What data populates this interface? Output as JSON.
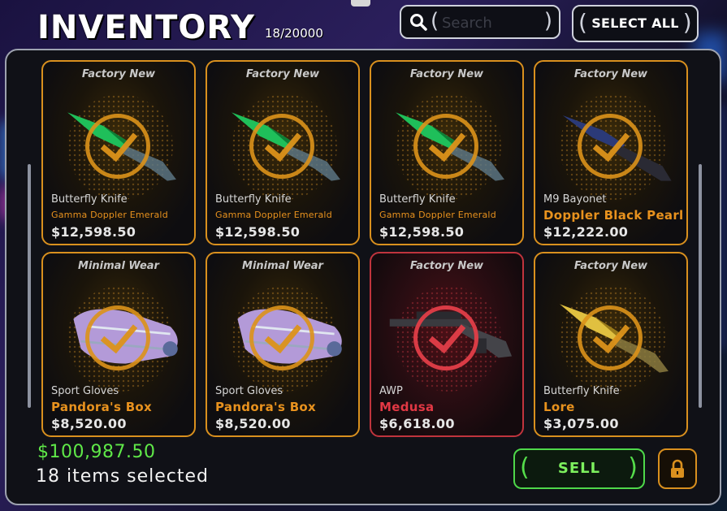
{
  "header": {
    "title": "INVENTORY",
    "count": "18/20000",
    "search_placeholder": "Search",
    "select_all_label": "SELECT ALL"
  },
  "colors": {
    "accent_orange": "#d9901e",
    "accent_red": "#c0343d",
    "sell_green": "#4ed84a",
    "total_green": "#5fe848"
  },
  "items": [
    {
      "condition": "Factory New",
      "weapon": "Butterfly Knife",
      "skin": "Gamma Doppler Emerald",
      "price": "$12,598.50",
      "rarity": "orange",
      "icon": "butterfly-knife-green-icon"
    },
    {
      "condition": "Factory New",
      "weapon": "Butterfly Knife",
      "skin": "Gamma Doppler Emerald",
      "price": "$12,598.50",
      "rarity": "orange",
      "icon": "butterfly-knife-green-icon"
    },
    {
      "condition": "Factory New",
      "weapon": "Butterfly Knife",
      "skin": "Gamma Doppler Emerald",
      "price": "$12,598.50",
      "rarity": "orange",
      "icon": "butterfly-knife-green-icon"
    },
    {
      "condition": "Factory New",
      "weapon": "M9 Bayonet",
      "skin": "Doppler Black Pearl",
      "price": "$12,222.00",
      "rarity": "orange",
      "icon": "m9-bayonet-icon"
    },
    {
      "condition": "Minimal Wear",
      "weapon": "Sport Gloves",
      "skin": "Pandora's Box",
      "price": "$8,520.00",
      "rarity": "orange",
      "icon": "sport-gloves-icon"
    },
    {
      "condition": "Minimal Wear",
      "weapon": "Sport Gloves",
      "skin": "Pandora's Box",
      "price": "$8,520.00",
      "rarity": "orange",
      "icon": "sport-gloves-icon"
    },
    {
      "condition": "Factory New",
      "weapon": "AWP",
      "skin": "Medusa",
      "price": "$6,618.00",
      "rarity": "red",
      "icon": "awp-rifle-icon"
    },
    {
      "condition": "Factory New",
      "weapon": "Butterfly Knife",
      "skin": "Lore",
      "price": "$3,075.00",
      "rarity": "orange",
      "icon": "butterfly-knife-gold-icon"
    }
  ],
  "footer": {
    "total": "$100,987.50",
    "selected_text": "18 items selected",
    "sell_label": "SELL",
    "lock_icon": "lock-icon"
  }
}
